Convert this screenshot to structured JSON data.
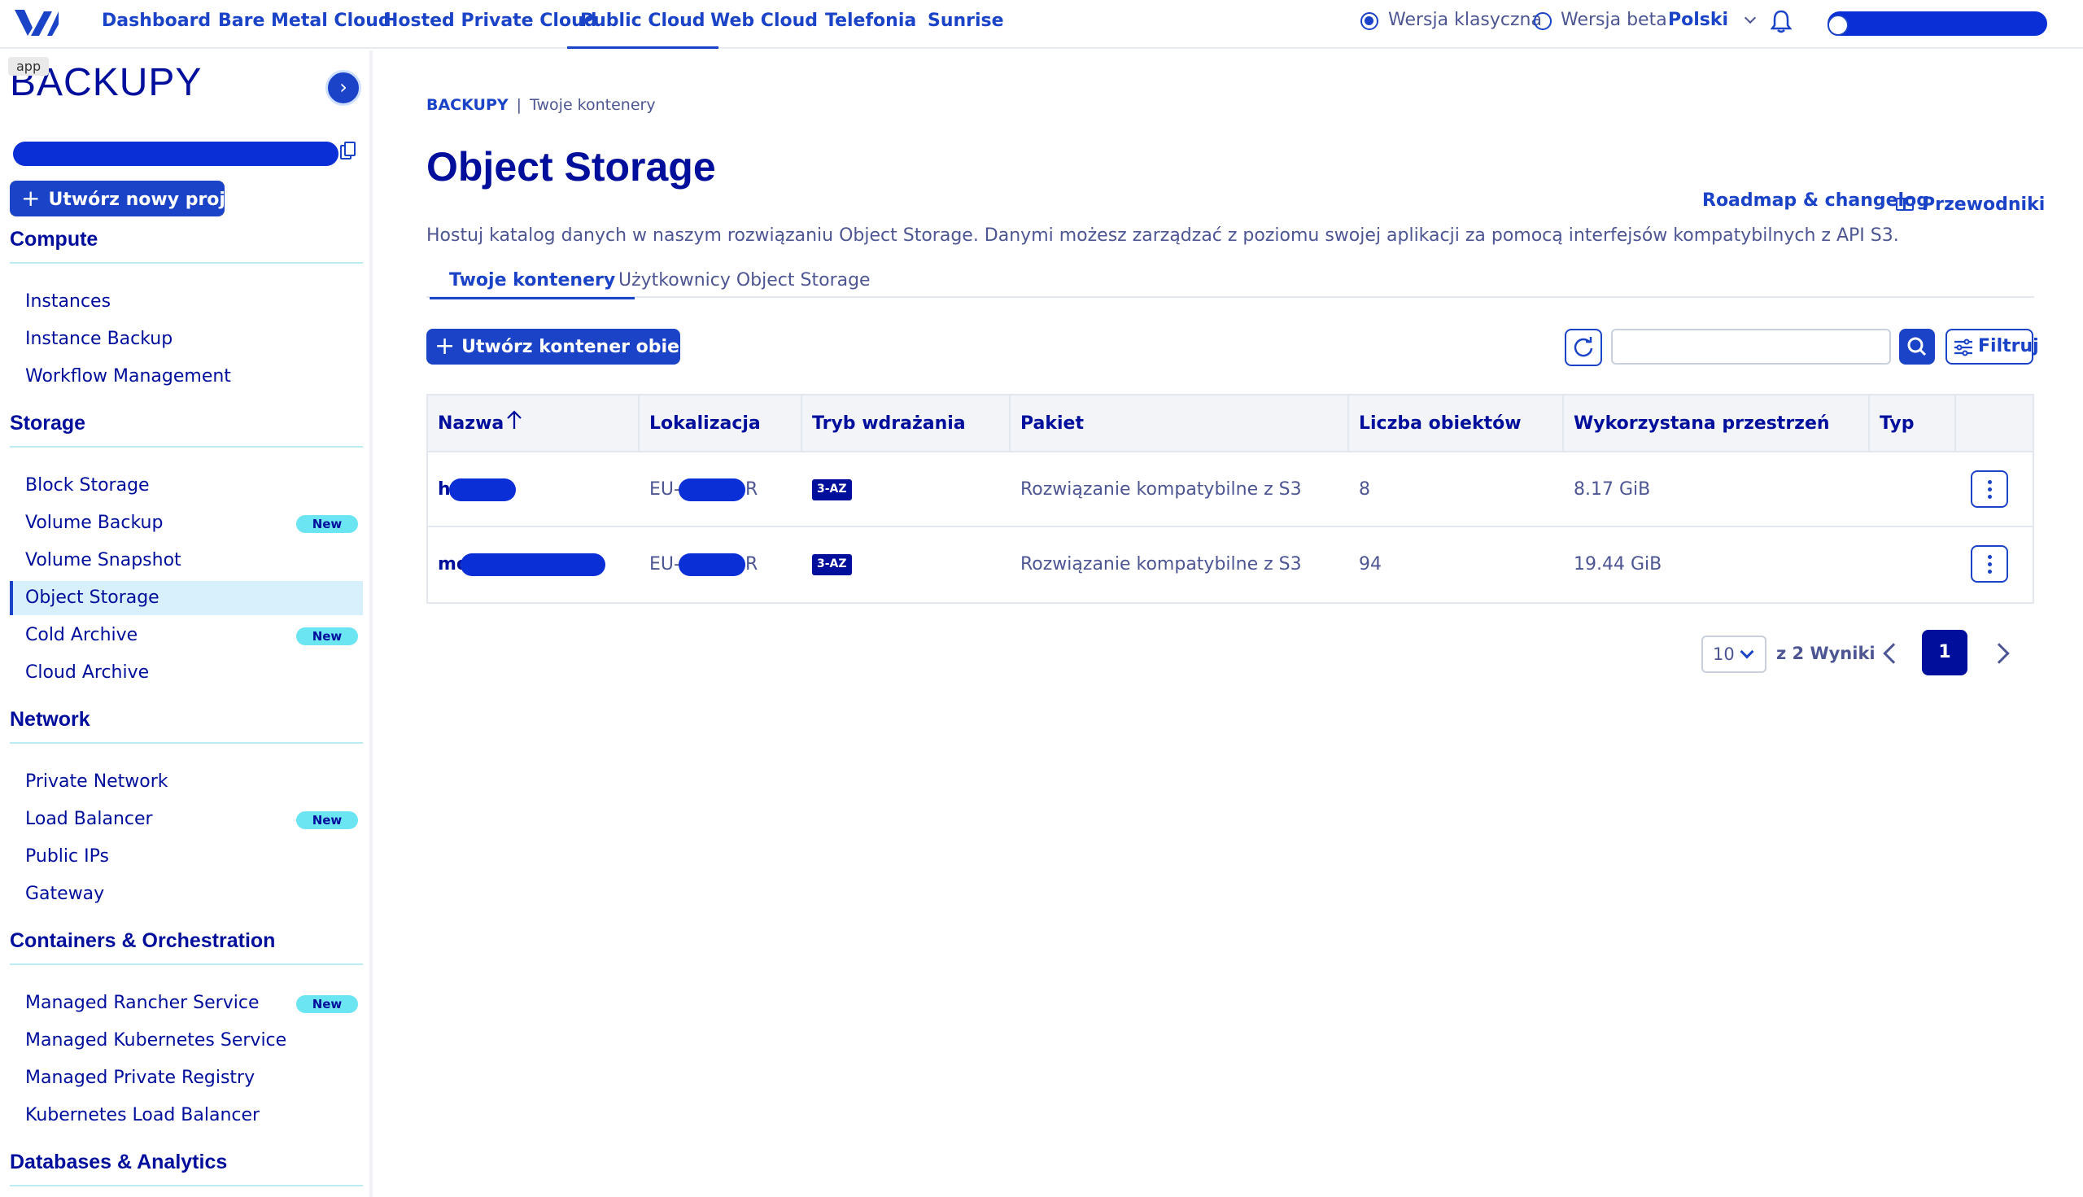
{
  "topnav": {
    "items": [
      {
        "label": "Dashboard",
        "active": false
      },
      {
        "label": "Bare Metal Cloud",
        "active": false
      },
      {
        "label": "Hosted Private Cloud",
        "active": false
      },
      {
        "label": "Public Cloud",
        "active": true
      },
      {
        "label": "Web Cloud",
        "active": false
      },
      {
        "label": "Telefonia",
        "active": false
      },
      {
        "label": "Sunrise",
        "active": false
      }
    ],
    "version_classic_label": "Wersja klasyczna",
    "version_beta_label": "Wersja beta",
    "language": "Polski"
  },
  "sidebar": {
    "app_badge": "app",
    "project_title": "BACKUPY",
    "new_project_label": "Utwórz nowy projekt",
    "sections": [
      {
        "title": "Compute",
        "items": [
          {
            "label": "Instances"
          },
          {
            "label": "Instance Backup"
          },
          {
            "label": "Workflow Management"
          }
        ]
      },
      {
        "title": "Storage",
        "items": [
          {
            "label": "Block Storage"
          },
          {
            "label": "Volume Backup",
            "badge": "New"
          },
          {
            "label": "Volume Snapshot"
          },
          {
            "label": "Object Storage",
            "active": true
          },
          {
            "label": "Cold Archive",
            "badge": "New"
          },
          {
            "label": "Cloud Archive"
          }
        ]
      },
      {
        "title": "Network",
        "items": [
          {
            "label": "Private Network"
          },
          {
            "label": "Load Balancer",
            "badge": "New"
          },
          {
            "label": "Public IPs"
          },
          {
            "label": "Gateway"
          }
        ]
      },
      {
        "title": "Containers & Orchestration",
        "items": [
          {
            "label": "Managed Rancher Service",
            "badge": "New"
          },
          {
            "label": "Managed Kubernetes Service"
          },
          {
            "label": "Managed Private Registry"
          },
          {
            "label": "Kubernetes Load Balancer"
          }
        ]
      },
      {
        "title": "Databases & Analytics",
        "items": []
      }
    ]
  },
  "main": {
    "breadcrumb": {
      "root": "BACKUPY",
      "separator": "|",
      "current": "Twoje kontenery"
    },
    "title": "Object Storage",
    "roadmap_link": "Roadmap & changelog",
    "guides_link": "Przewodniki",
    "description": "Hostuj katalog danych w naszym rozwiązaniu Object Storage. Danymi możesz zarządzać z poziomu swojej aplikacji za pomocą interfejsów kompatybilnych z API S3.",
    "tabs": [
      {
        "label": "Twoje kontenery",
        "active": true
      },
      {
        "label": "Użytkownicy Object Storage",
        "active": false
      }
    ],
    "create_button": "Utwórz kontener obiektów",
    "search": {
      "value": "",
      "placeholder": ""
    },
    "filter_button": "Filtruj"
  },
  "table": {
    "columns": [
      "Nazwa",
      "Lokalizacja",
      "Tryb wdrażania",
      "Pakiet",
      "Liczba obiektów",
      "Wykorzystana przestrzeń",
      "Typ"
    ],
    "rows": [
      {
        "name_visible": "h",
        "location_prefix": "EU-",
        "location_suffix": "R",
        "mode": "3-AZ",
        "package": "Rozwiązanie kompatybilne z S3",
        "objects": "8",
        "used": "8.17 GiB",
        "type": ""
      },
      {
        "name_visible": "mo",
        "location_prefix": "EU-",
        "location_suffix": "R",
        "mode": "3-AZ",
        "package": "Rozwiązanie kompatybilne z S3",
        "objects": "94",
        "used": "19.44 GiB",
        "type": ""
      }
    ]
  },
  "pagination": {
    "page_size": "10",
    "results_text": "z 2 Wyniki",
    "current_page": "1"
  },
  "colors": {
    "primary": "#1a43c7",
    "navy": "#000e9c",
    "badge_new": "#6ce5f2",
    "active_bg": "#d8f0fb"
  }
}
